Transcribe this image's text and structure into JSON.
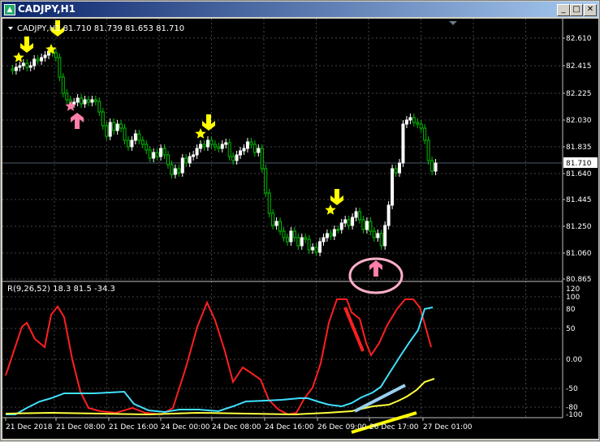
{
  "window": {
    "title": "CADJPY,H1",
    "buttons": {
      "minimize": "_",
      "maximize": "□",
      "close": "✕"
    }
  },
  "main_chart": {
    "header": "CADJPY,H1  81.710 81.739 81.653 81.710",
    "price_ticks": [
      "82.610",
      "82.415",
      "82.225",
      "82.030",
      "81.835",
      "81.640",
      "81.445",
      "81.250",
      "81.060",
      "80.865"
    ],
    "current_price": "81.710"
  },
  "indicator": {
    "header": "R(9,26,52) 18.3 81.5 -34.3",
    "ticks": [
      "120",
      "100",
      "80",
      "50",
      "0.00",
      "-50",
      "-80",
      "-100"
    ]
  },
  "time_axis": [
    "21 Dec 2018",
    "21 Dec 08:00",
    "21 Dec 16:00",
    "24 Dec 00:00",
    "24 Dec 08:00",
    "24 Dec 16:00",
    "26 Dec 09:00",
    "26 Dec 17:00",
    "27 Dec 01:00"
  ],
  "colors": {
    "background": "#000000",
    "grid": "#3a3a3a",
    "candle_bull": "#ffffff",
    "candle_bear": "#00c000",
    "red_line": "#ff2020",
    "cyan_line": "#40e0ff",
    "yellow_line": "#ffff40",
    "sell_arrow": "#ffff00",
    "buy_arrow": "#ff7fa8",
    "circle": "#ffb0c8"
  }
}
